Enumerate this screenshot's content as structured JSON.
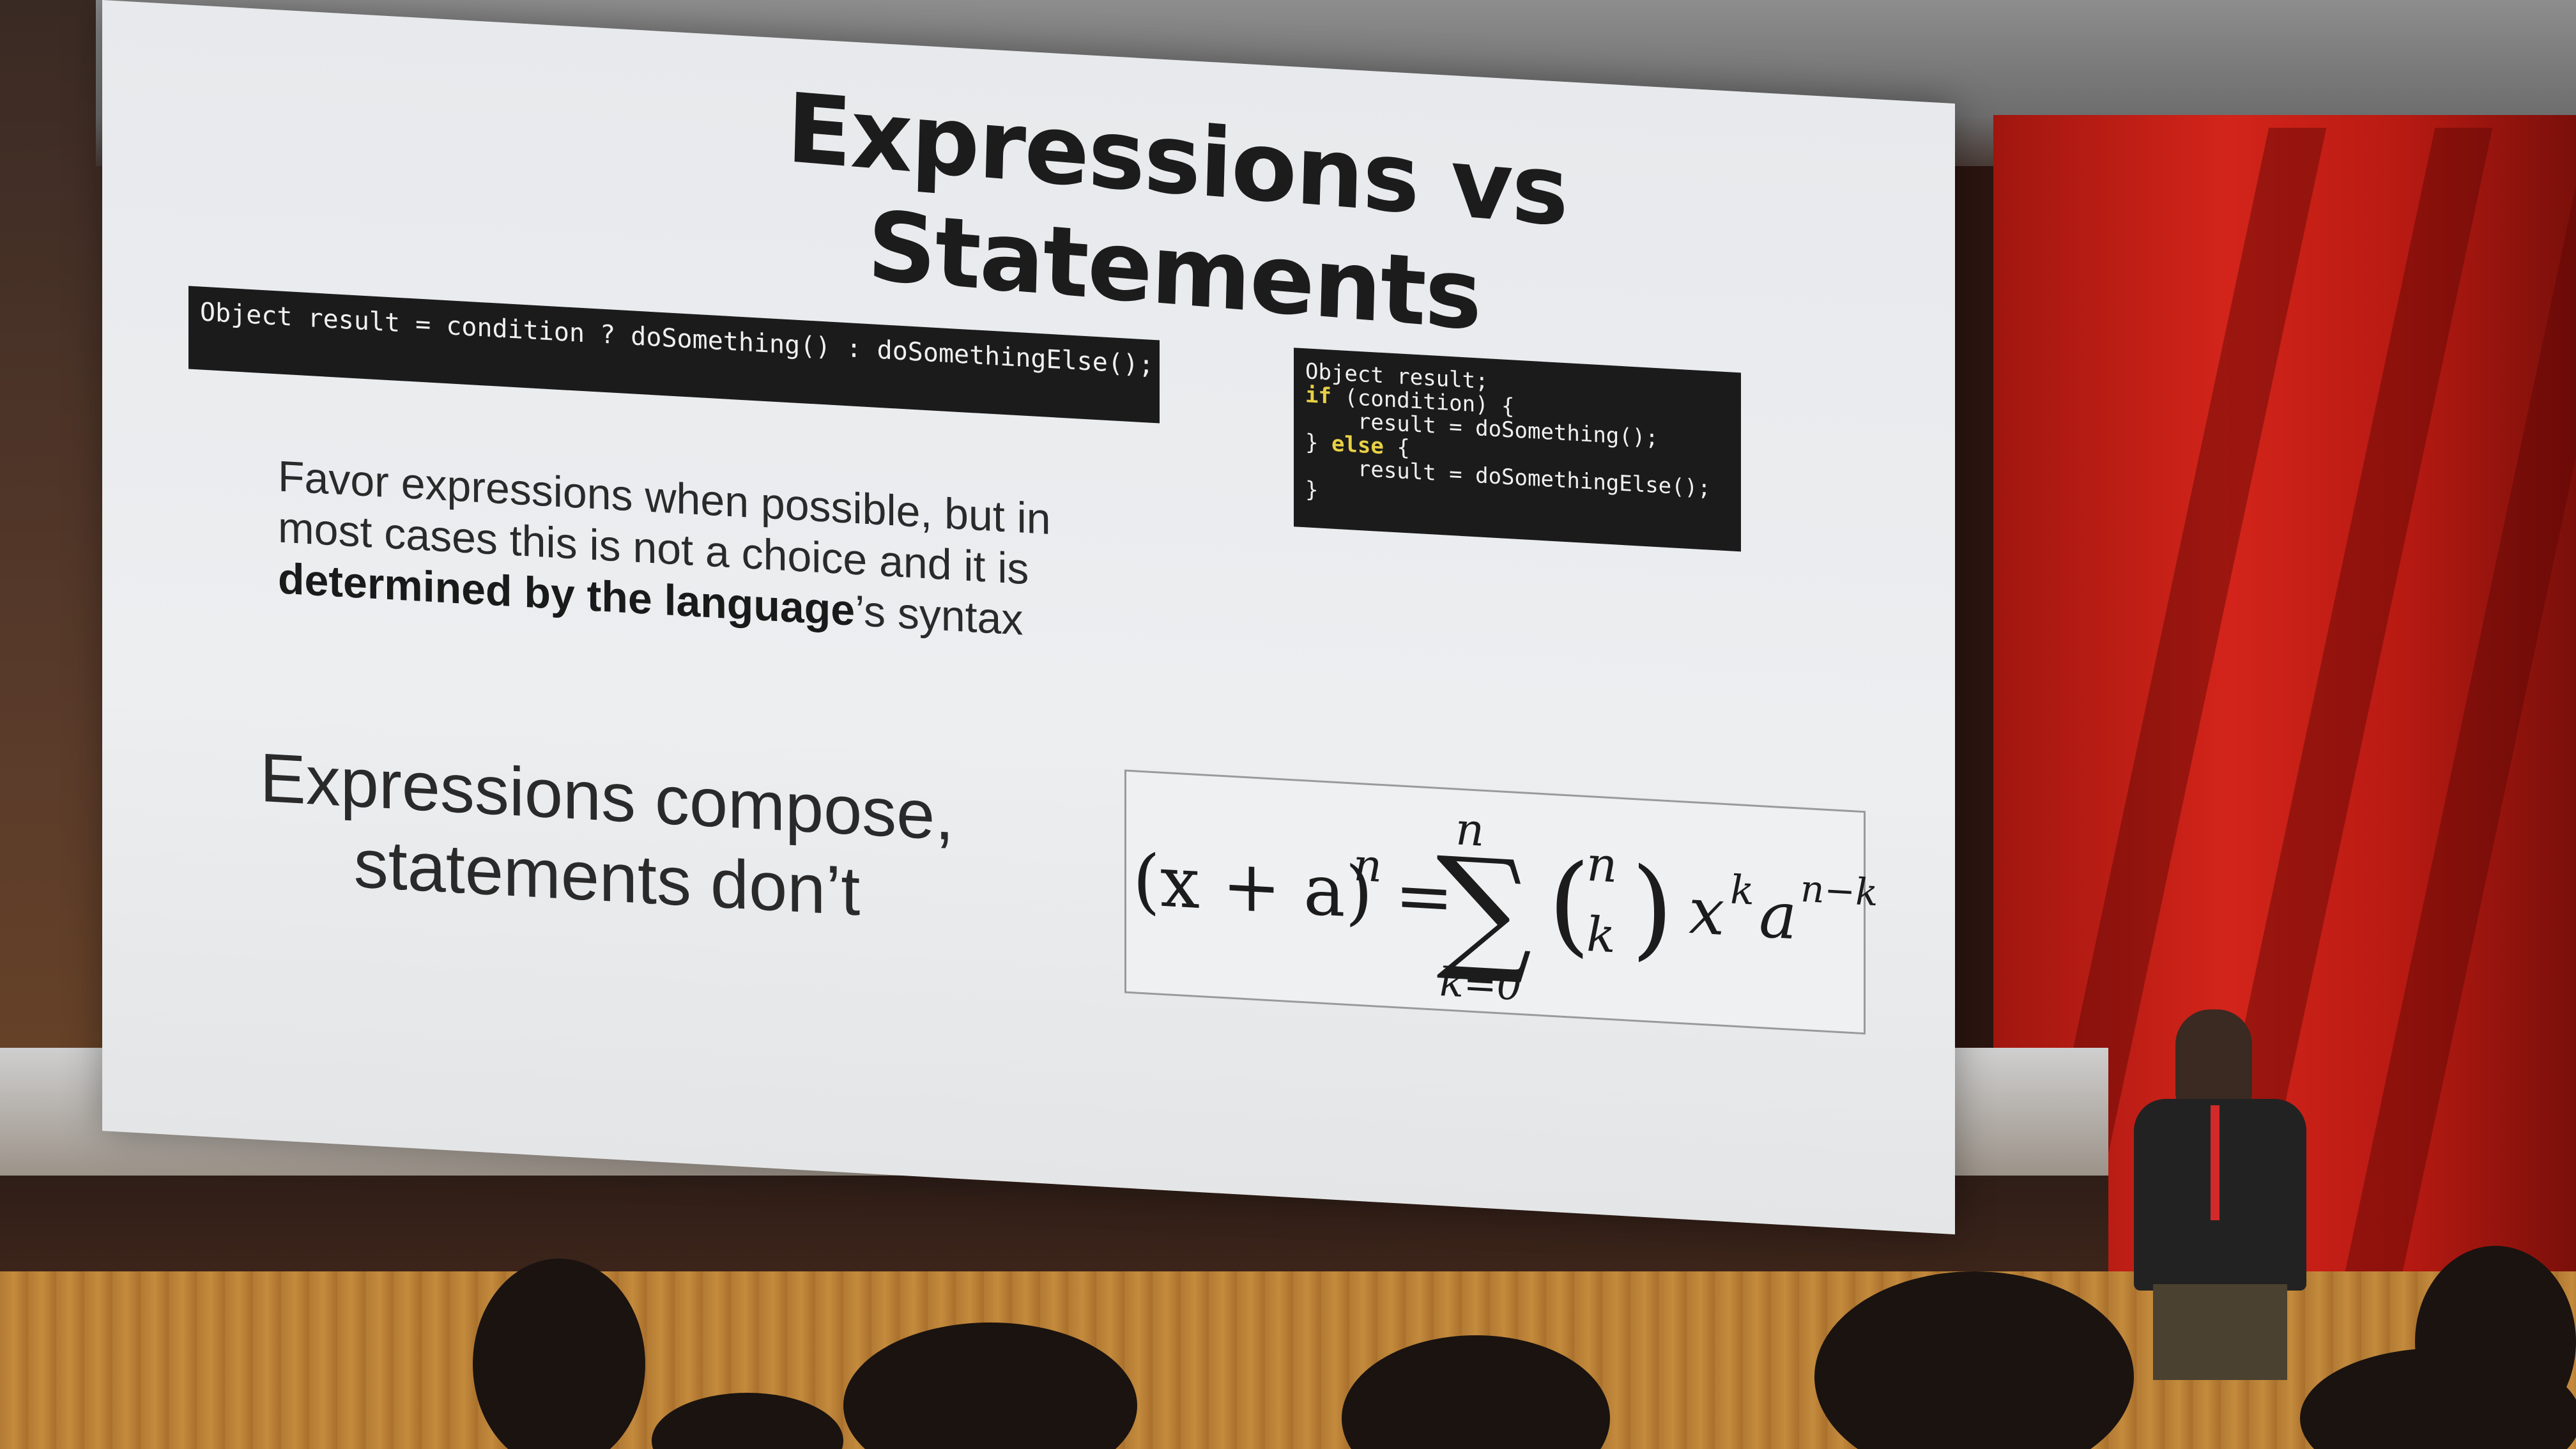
{
  "slide": {
    "title": "Expressions vs Statements",
    "code_inline": "Object result = condition ? doSomething() : doSomethingElse();",
    "code_block": {
      "lines": [
        {
          "parts": [
            {
              "text": "Object result;",
              "kw": false
            }
          ]
        },
        {
          "parts": [
            {
              "text": "if",
              "kw": true
            },
            {
              "text": " (condition) {",
              "kw": false
            }
          ]
        },
        {
          "parts": [
            {
              "text": "    result = doSomething();",
              "kw": false
            }
          ]
        },
        {
          "parts": [
            {
              "text": "} ",
              "kw": false
            },
            {
              "text": "else",
              "kw": true
            },
            {
              "text": " {",
              "kw": false
            }
          ]
        },
        {
          "parts": [
            {
              "text": "    result = doSomethingElse();",
              "kw": false
            }
          ]
        },
        {
          "parts": [
            {
              "text": "}",
              "kw": false
            }
          ]
        }
      ]
    },
    "favor": {
      "part1": "Favor expressions when possible, but in most cases this is not a choice and it is ",
      "bold": "determined by the language",
      "part2": "’s syntax"
    },
    "compose": {
      "line1": "Expressions compose,",
      "line2": "statements don’t"
    },
    "formula": {
      "lhs": "(x + a)",
      "lhs_exp": "n",
      "equals": "=",
      "sigma": "∑",
      "upper": "n",
      "lower": "k=0",
      "binom_top": "n",
      "binom_bottom": "k",
      "x": "x",
      "x_exp": "k",
      "a": "a",
      "a_exp": "n−k"
    }
  }
}
